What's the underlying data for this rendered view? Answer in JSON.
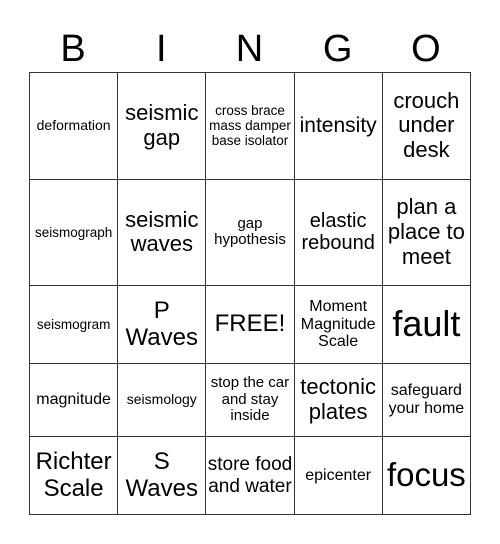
{
  "header": [
    "B",
    "I",
    "N",
    "G",
    "O"
  ],
  "rows": [
    [
      {
        "text": "deformation",
        "size": 14
      },
      {
        "text": "seismic gap",
        "size": 22
      },
      {
        "text": "cross brace mass damper base isolator",
        "size": 13.5
      },
      {
        "text": "intensity",
        "size": 21
      },
      {
        "text": "crouch under desk",
        "size": 22
      }
    ],
    [
      {
        "text": "seismograph",
        "size": 13.5
      },
      {
        "text": "seismic waves",
        "size": 22
      },
      {
        "text": "gap hypothesis",
        "size": 15
      },
      {
        "text": "elastic rebound",
        "size": 20
      },
      {
        "text": "plan a place to meet",
        "size": 22
      }
    ],
    [
      {
        "text": "seismogram",
        "size": 13.5
      },
      {
        "text": "P Waves",
        "size": 24
      },
      {
        "text": "FREE!",
        "size": 24
      },
      {
        "text": "Moment Magnitude Scale",
        "size": 16
      },
      {
        "text": "fault",
        "size": 36
      }
    ],
    [
      {
        "text": "magnitude",
        "size": 16
      },
      {
        "text": "seismology",
        "size": 14
      },
      {
        "text": "stop the car and stay inside",
        "size": 15
      },
      {
        "text": "tectonic plates",
        "size": 22
      },
      {
        "text": "safeguard your home",
        "size": 16
      }
    ],
    [
      {
        "text": "Richter Scale",
        "size": 24
      },
      {
        "text": "S Waves",
        "size": 24
      },
      {
        "text": "store food and water",
        "size": 19
      },
      {
        "text": "epicenter",
        "size": 16
      },
      {
        "text": "focus",
        "size": 33
      }
    ]
  ]
}
